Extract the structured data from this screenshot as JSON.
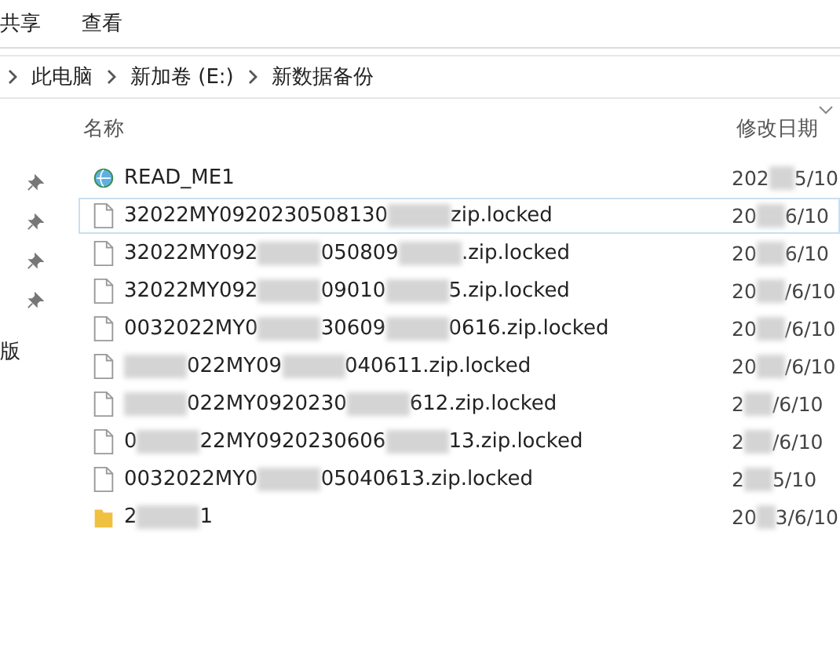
{
  "ribbon": {
    "tabs": [
      {
        "label": "共享",
        "selected": false
      },
      {
        "label": "查看",
        "selected": false
      }
    ]
  },
  "address_bar": {
    "crumbs": [
      "此电脑",
      "新加卷 (E:)",
      "新数据备份"
    ]
  },
  "nav_pane": {
    "items": [
      {
        "pinned": true
      },
      {
        "pinned": true
      },
      {
        "pinned": true
      },
      {
        "pinned": true
      }
    ],
    "label": "版"
  },
  "columns": [
    "名称",
    "修改日期"
  ],
  "rows": [
    {
      "kind": "web",
      "focused": false,
      "name": [
        {
          "text": "READ_ME1"
        }
      ],
      "date": [
        {
          "text": "202"
        },
        {
          "kind": "redacted"
        },
        {
          "text": "5/10"
        }
      ]
    },
    {
      "kind": "file",
      "focused": true,
      "name": [
        {
          "text": "32022MY0920230508130"
        },
        {
          "kind": "redacted"
        },
        {
          "text": "zip.locked"
        }
      ],
      "date": [
        {
          "text": "20"
        },
        {
          "kind": "redacted"
        },
        {
          "text": "6/10"
        }
      ]
    },
    {
      "kind": "file",
      "focused": false,
      "name": [
        {
          "text": "32022MY092"
        },
        {
          "kind": "redacted"
        },
        {
          "text": "050809"
        },
        {
          "kind": "redacted"
        },
        {
          "text": ".zip.locked"
        }
      ],
      "date": [
        {
          "text": "20"
        },
        {
          "kind": "redacted"
        },
        {
          "text": "6/10"
        }
      ]
    },
    {
      "kind": "file",
      "focused": false,
      "name": [
        {
          "text": "32022MY092"
        },
        {
          "kind": "redacted"
        },
        {
          "text": "09010"
        },
        {
          "kind": "redacted"
        },
        {
          "text": "5.zip.locked"
        }
      ],
      "date": [
        {
          "text": "20"
        },
        {
          "kind": "redacted"
        },
        {
          "text": "/6/10"
        }
      ]
    },
    {
      "kind": "file",
      "focused": false,
      "name": [
        {
          "text": "0032022MY0"
        },
        {
          "kind": "redacted"
        },
        {
          "text": "30609"
        },
        {
          "kind": "redacted"
        },
        {
          "text": "0616.zip.locked"
        }
      ],
      "date": [
        {
          "text": "20"
        },
        {
          "kind": "redacted"
        },
        {
          "text": "/6/10"
        }
      ]
    },
    {
      "kind": "file",
      "focused": false,
      "name": [
        {
          "kind": "redacted"
        },
        {
          "text": "022MY09"
        },
        {
          "kind": "redacted"
        },
        {
          "text": "040611.zip.locked"
        }
      ],
      "date": [
        {
          "text": "20"
        },
        {
          "kind": "redacted"
        },
        {
          "text": "/6/10"
        }
      ]
    },
    {
      "kind": "file",
      "focused": false,
      "name": [
        {
          "kind": "redacted"
        },
        {
          "text": "022MY0920230"
        },
        {
          "kind": "redacted"
        },
        {
          "text": "612.zip.locked"
        }
      ],
      "date": [
        {
          "text": "2"
        },
        {
          "kind": "redacted"
        },
        {
          "text": "/6/10"
        }
      ]
    },
    {
      "kind": "file",
      "focused": false,
      "name": [
        {
          "text": "0"
        },
        {
          "kind": "redacted"
        },
        {
          "text": "22MY0920230606"
        },
        {
          "kind": "redacted"
        },
        {
          "text": "13.zip.locked"
        }
      ],
      "date": [
        {
          "text": "2"
        },
        {
          "kind": "redacted"
        },
        {
          "text": "/6/10"
        }
      ]
    },
    {
      "kind": "file",
      "focused": false,
      "name": [
        {
          "text": "0032022MY0"
        },
        {
          "kind": "redacted"
        },
        {
          "text": "05040613.zip.locked"
        }
      ],
      "date": [
        {
          "text": "2"
        },
        {
          "kind": "redacted"
        },
        {
          "text": "5/10"
        }
      ]
    },
    {
      "kind": "folder",
      "focused": false,
      "name": [
        {
          "text": "2"
        },
        {
          "kind": "redacted"
        },
        {
          "text": "1"
        }
      ],
      "date": [
        {
          "text": "20"
        },
        {
          "kind": "redacted"
        },
        {
          "text": "3/6/10"
        }
      ]
    }
  ]
}
